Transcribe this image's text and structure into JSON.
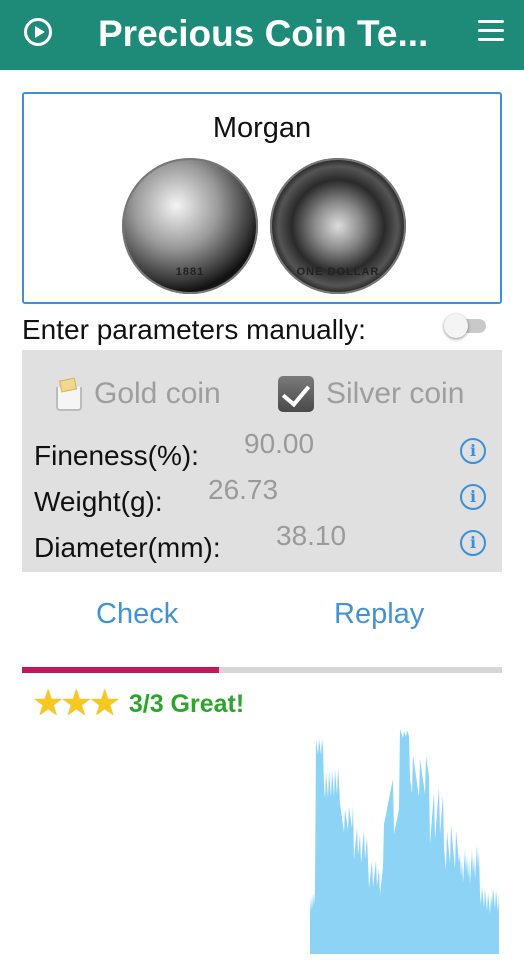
{
  "appbar": {
    "title": "Precious Coin Te..."
  },
  "coin": {
    "name": "Morgan",
    "obverse_year": "1881",
    "reverse_text": "ONE DOLLAR"
  },
  "manual": {
    "label": "Enter parameters manually:",
    "enabled": false
  },
  "coin_type": {
    "gold_label": "Gold coin",
    "silver_label": "Silver coin",
    "selected": "silver"
  },
  "params": [
    {
      "label": "Fineness(%):",
      "value": "90.00"
    },
    {
      "label": "Weight(g):",
      "value": "26.73"
    },
    {
      "label": "Diameter(mm):",
      "value": "38.10"
    }
  ],
  "buttons": {
    "check": "Check",
    "replay": "Replay"
  },
  "progress": {
    "fraction": 0.41
  },
  "result": {
    "stars": 3,
    "text": "3/3 Great!"
  },
  "colors": {
    "appbar": "#1e8a78",
    "accent_blue": "#4193d6",
    "progress_fill": "#c2185b",
    "result_green": "#2da52d",
    "spectrum": "#8dd3f5"
  }
}
